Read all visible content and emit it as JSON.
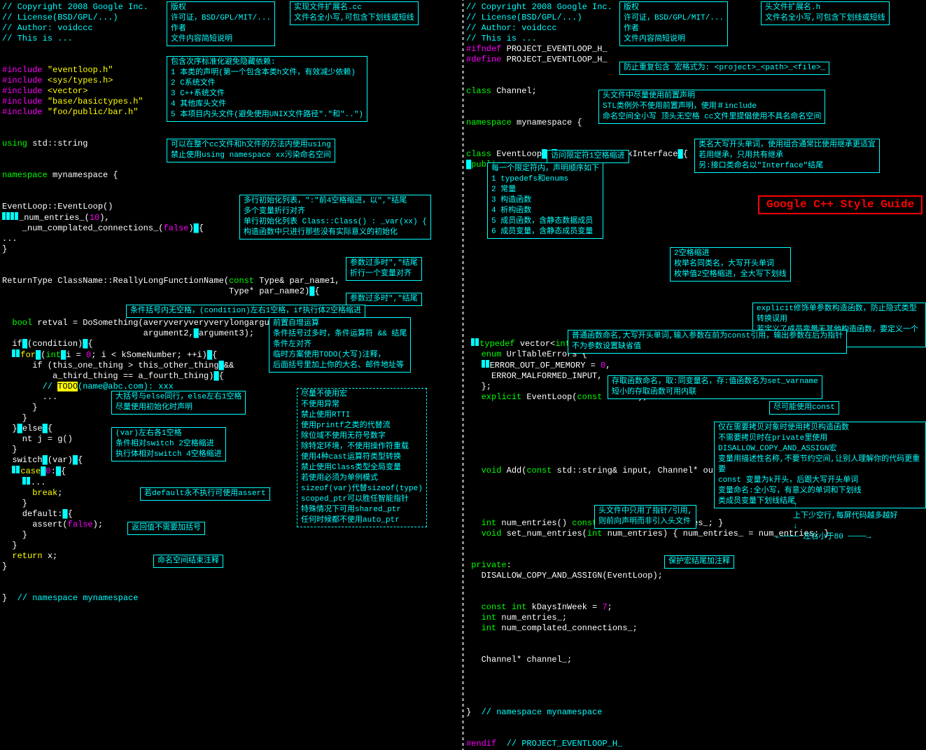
{
  "title": "Google C++ Style Guide",
  "left": {
    "code": [
      "// Copyright 2008 Google Inc.",
      "// License(BSD/GPL/...)",
      "// Author: voidccc",
      "// This is ...",
      "",
      "#include \"eventloop.h\"",
      "#include <sys/types.h>",
      "#include <vector>",
      "#include \"base/basictypes.h\"",
      "#include \"foo/public/bar.h\"",
      "",
      "using std::string",
      "",
      "namespace mynamespace {",
      "",
      "EventLoop::EventLoop()",
      "    _num_entries_(10),",
      "    _num_complated_connections_(false)",
      "...",
      "}",
      "",
      "ReturnType ClassName::ReallyLongFunctionName(const Type& par_name1,",
      "                                             Type* par_name2) {",
      "",
      "  bool retval = DoSomething(averyveryveryverylongargument1,",
      "                            argument2, argument3);",
      "  if (condition) {",
      "    for (int i = 0; i < kSomeNumber; ++i) {",
      "      if (this_one_thing > this_other_thing &&",
      "          a_third_thing == a_fourth_thing) {",
      "        // TODO(name@abc.com): xxx",
      "        ...",
      "      }",
      "    }",
      "  } else {",
      "    nt j = g()",
      "  }",
      "  switch (var) {",
      "    case 0: {",
      "      ...",
      "      break;",
      "    }",
      "    default: {",
      "      assert(false);",
      "    }",
      "  }",
      "  return x;",
      "}",
      "",
      "}  // namespace mynamespace"
    ],
    "notes": {
      "n1": "版权\n许可证，BSD/GPL/MIT/...\n作者\n文件内容简短说明",
      "n2": "实现文件扩展名.cc\n文件名全小写,可包含下划线或短线",
      "n3": "包含次序标准化避免隐藏依赖:\n1 本类的声明(第一个包含本类h文件，有效减少依赖)\n2 C系统文件\n3 C++系统文件\n4 其他库头文件\n5 本项目内头文件(避免使用UNIX文件路径\".\"和\"..\")",
      "n4": "可以在整个cc文件和h文件的方法内使用using\n禁止使用using namespace xx污染命名空间",
      "n5": "多行初始化列表，\":\"前4空格缩进，以\",\"结尾\n多个变量折行对齐\n单行初始化列表 Class::Class() : _var(xx) {\n构造函数中只进行那些没有实际意义的初始化",
      "n6": "参数过多时\",\"结尾\n折行一个变量对齐",
      "n7": "参数过多时\",\"结尾",
      "n8": "条件括号内无空格，(condition)左右1空格，if执行体2空格缩进",
      "n9": "前置自增运算\n条件括号过多时，条件运算符 && 结尾\n条件左对齐\n临时方案使用TODO(大写)注释，\n后面括号里加上你的大名、邮件地址等",
      "n10": "大括号与else同行，else左右1空格\n尽量使用初始化时声明",
      "n11": "尽量不使用宏\n不使用异常\n禁止使用RTTI\n使用printf之类的代替流\n除位域不使用无符号数字\n除特定环境，不使用操作符重载\n使用4种cast运算符类型转换\n禁止使用Class类型全局变量\n若使用必须为单例模式\nsizeof(var)代替sizeof(type)\nscoped_ptr可以胜任智能指针\n特殊情况下可用shared_ptr\n任何时候都不使用auto_ptr",
      "n12": "(var)左右各1空格\n条件相对switch 2空格缩进\n执行体相对switch 4空格缩进",
      "n13": "若default永不执行可使用assert",
      "n14": "返回值不需要加括号",
      "n15": "命名空间结束注释"
    }
  },
  "right": {
    "code": [
      "// Copyright 2008 Google Inc.",
      "// License(BSD/GPL/...)",
      "// Author: voidccc",
      "// This is ...",
      "#ifndef PROJECT_EVENTLOOP_H_",
      "#define PROJECT_EVENTLOOP_H_",
      "",
      "class Channel;",
      "",
      "namespace mynamespace {",
      "",
      "class EventLoop : public CallbackInterface {",
      " public:",
      "",
      "",
      "",
      "",
      "",
      "",
      "",
      "",
      "   typedef vector<int> IntVector;",
      "   enum UrlTableErrors {",
      "     ERROR_OUT_OF_MEMORY = 0,",
      "     ERROR_MALFORMED_INPUT,",
      "   };",
      "   explicit EventLoop(const int xx);",
      "",
      "",
      "",
      "   void Add(const std::string& input, Channel* output)",
      "",
      "",
      "   int num_entries() const { return num_entries_; }",
      "   void set_num_entries(int num_entries) { num_entries_ = num_entries; }",
      "",
      " private:",
      "   DISALLOW_COPY_AND_ASSIGN(EventLoop);",
      "",
      "   const int kDaysInWeek = 7;",
      "   int num_entries_;",
      "   int num_complated_connections_;",
      "",
      "   Channel* channel_;",
      "",
      "",
      "}  // namespace mynamespace",
      "",
      "#endif  // PROJECT_EVENTLOOP_H_"
    ],
    "notes": {
      "r1": "版权\n许可证，BSD/GPL/MIT/...\n作者\n文件内容简短说明",
      "r2": "头文件扩展名.h\n文件名全小写,可包含下划线或短线",
      "r3": "防止重复包含  宏格式为:   <project>_<path>_<file>_",
      "r4": "头文件中尽量使用前置声明\nSTL类例外不使用前置声明，使用＃include\n命名空间全小写 顶头无空格 cc文件里提倡使用不具名命名空间",
      "r5": "类名大写开头单词，使用组合通常比使用继承更适宜\n若用继承，只用共有继承\n另:接口类命名以\"Interface\"结尾",
      "r6": "访问限定符1空格缩进",
      "r7": "每一个限定符内，声明顺序如下\n1 typedefs和enums\n2 常量\n3 构造函数\n4 析构函数\n5 成员函数，含静态数据成员\n6 成员变量，含静态成员变量",
      "r8": "2空格缩进\n枚举名同类名，大写开头单词\n枚举值2空格缩进，全大写下划线",
      "r9": "explicit修饰单参数构造函数，防止隐式类型转换误用\n若定义了成员变量无其他构造函数，要定义一个默认构造函数",
      "r10": "普通函数命名,大写开头单词,输入参数在前为const引用，输出参数在后为指针\n不为参数设置缺省值",
      "r11": "存取函数命名，取:同变量名，存:值函数名为set_varname\n短小的存取函数可用内联",
      "r12": "尽可能使用const",
      "r13": "仅在需要拷贝对象时使用拷贝构造函数\n不需要拷贝时在private里使用DISALLOW_COPY_AND_ASSIGN宏\n变量用描述性名称,不要节约空间,让别人理解你的代码更重要\nconst 变量为k开头，后跟大写开头单词\n变量命名:全小写，有意义的单词和下划线\n类成员变量下划线结尾",
      "r14": "头文件中只用了指针/引用,\n则前向声明而非引入头文件",
      "r15": "保护宏结尾加注释",
      "r16": "上下少空行,每屏代码越多越好",
      "r17": "左右小于80"
    }
  }
}
